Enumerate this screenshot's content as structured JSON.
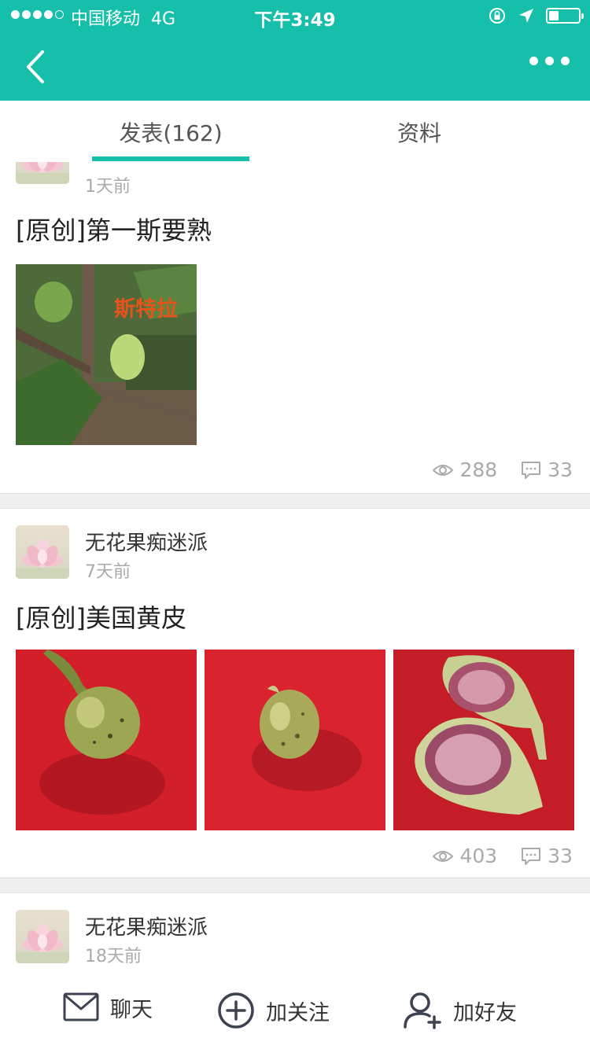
{
  "status_bar": {
    "carrier": "中国移动",
    "network": "4G",
    "time": "下午3:49"
  },
  "nav": {
    "back_icon": "chevron-left-icon",
    "more_icon": "more-dots-icon"
  },
  "tabs": [
    {
      "label": "发表(162)",
      "active": true
    },
    {
      "label": "资料",
      "active": false
    }
  ],
  "posts": [
    {
      "time": "1天前",
      "title": "[原创]第一斯要熟",
      "images": [
        {
          "overlay_text": "斯特拉"
        }
      ],
      "views": "288",
      "comments": "33"
    },
    {
      "author": "无花果痴迷派",
      "time": "7天前",
      "title": "[原创]美国黄皮",
      "images": [
        {},
        {},
        {}
      ],
      "views": "403",
      "comments": "33"
    },
    {
      "author": "无花果痴迷派",
      "time": "18天前"
    }
  ],
  "bottom_bar": {
    "chat": "聊天",
    "follow": "加关注",
    "add_friend": "加好友"
  },
  "colors": {
    "accent": "#15bfaa",
    "muted_text": "#aaaaaa"
  }
}
